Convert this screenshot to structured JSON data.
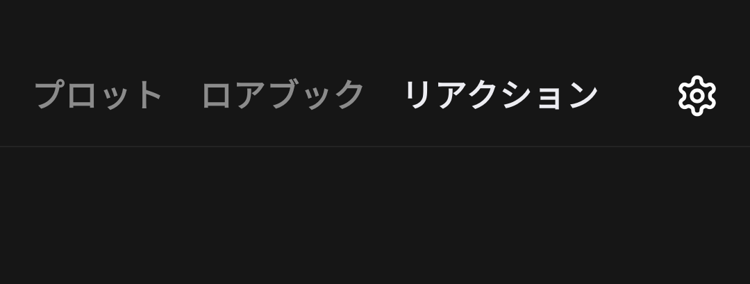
{
  "tabs": [
    {
      "label": "プロット",
      "state": "inactive"
    },
    {
      "label": "ロアブック",
      "state": "inactive"
    },
    {
      "label": "リアクション",
      "state": "active"
    }
  ],
  "settings": {
    "icon": "gear-icon"
  },
  "colors": {
    "background": "#161616",
    "tab_inactive": "#8b8b8b",
    "tab_active": "#ededf2",
    "icon": "#ffffff",
    "divider": "#232323"
  }
}
